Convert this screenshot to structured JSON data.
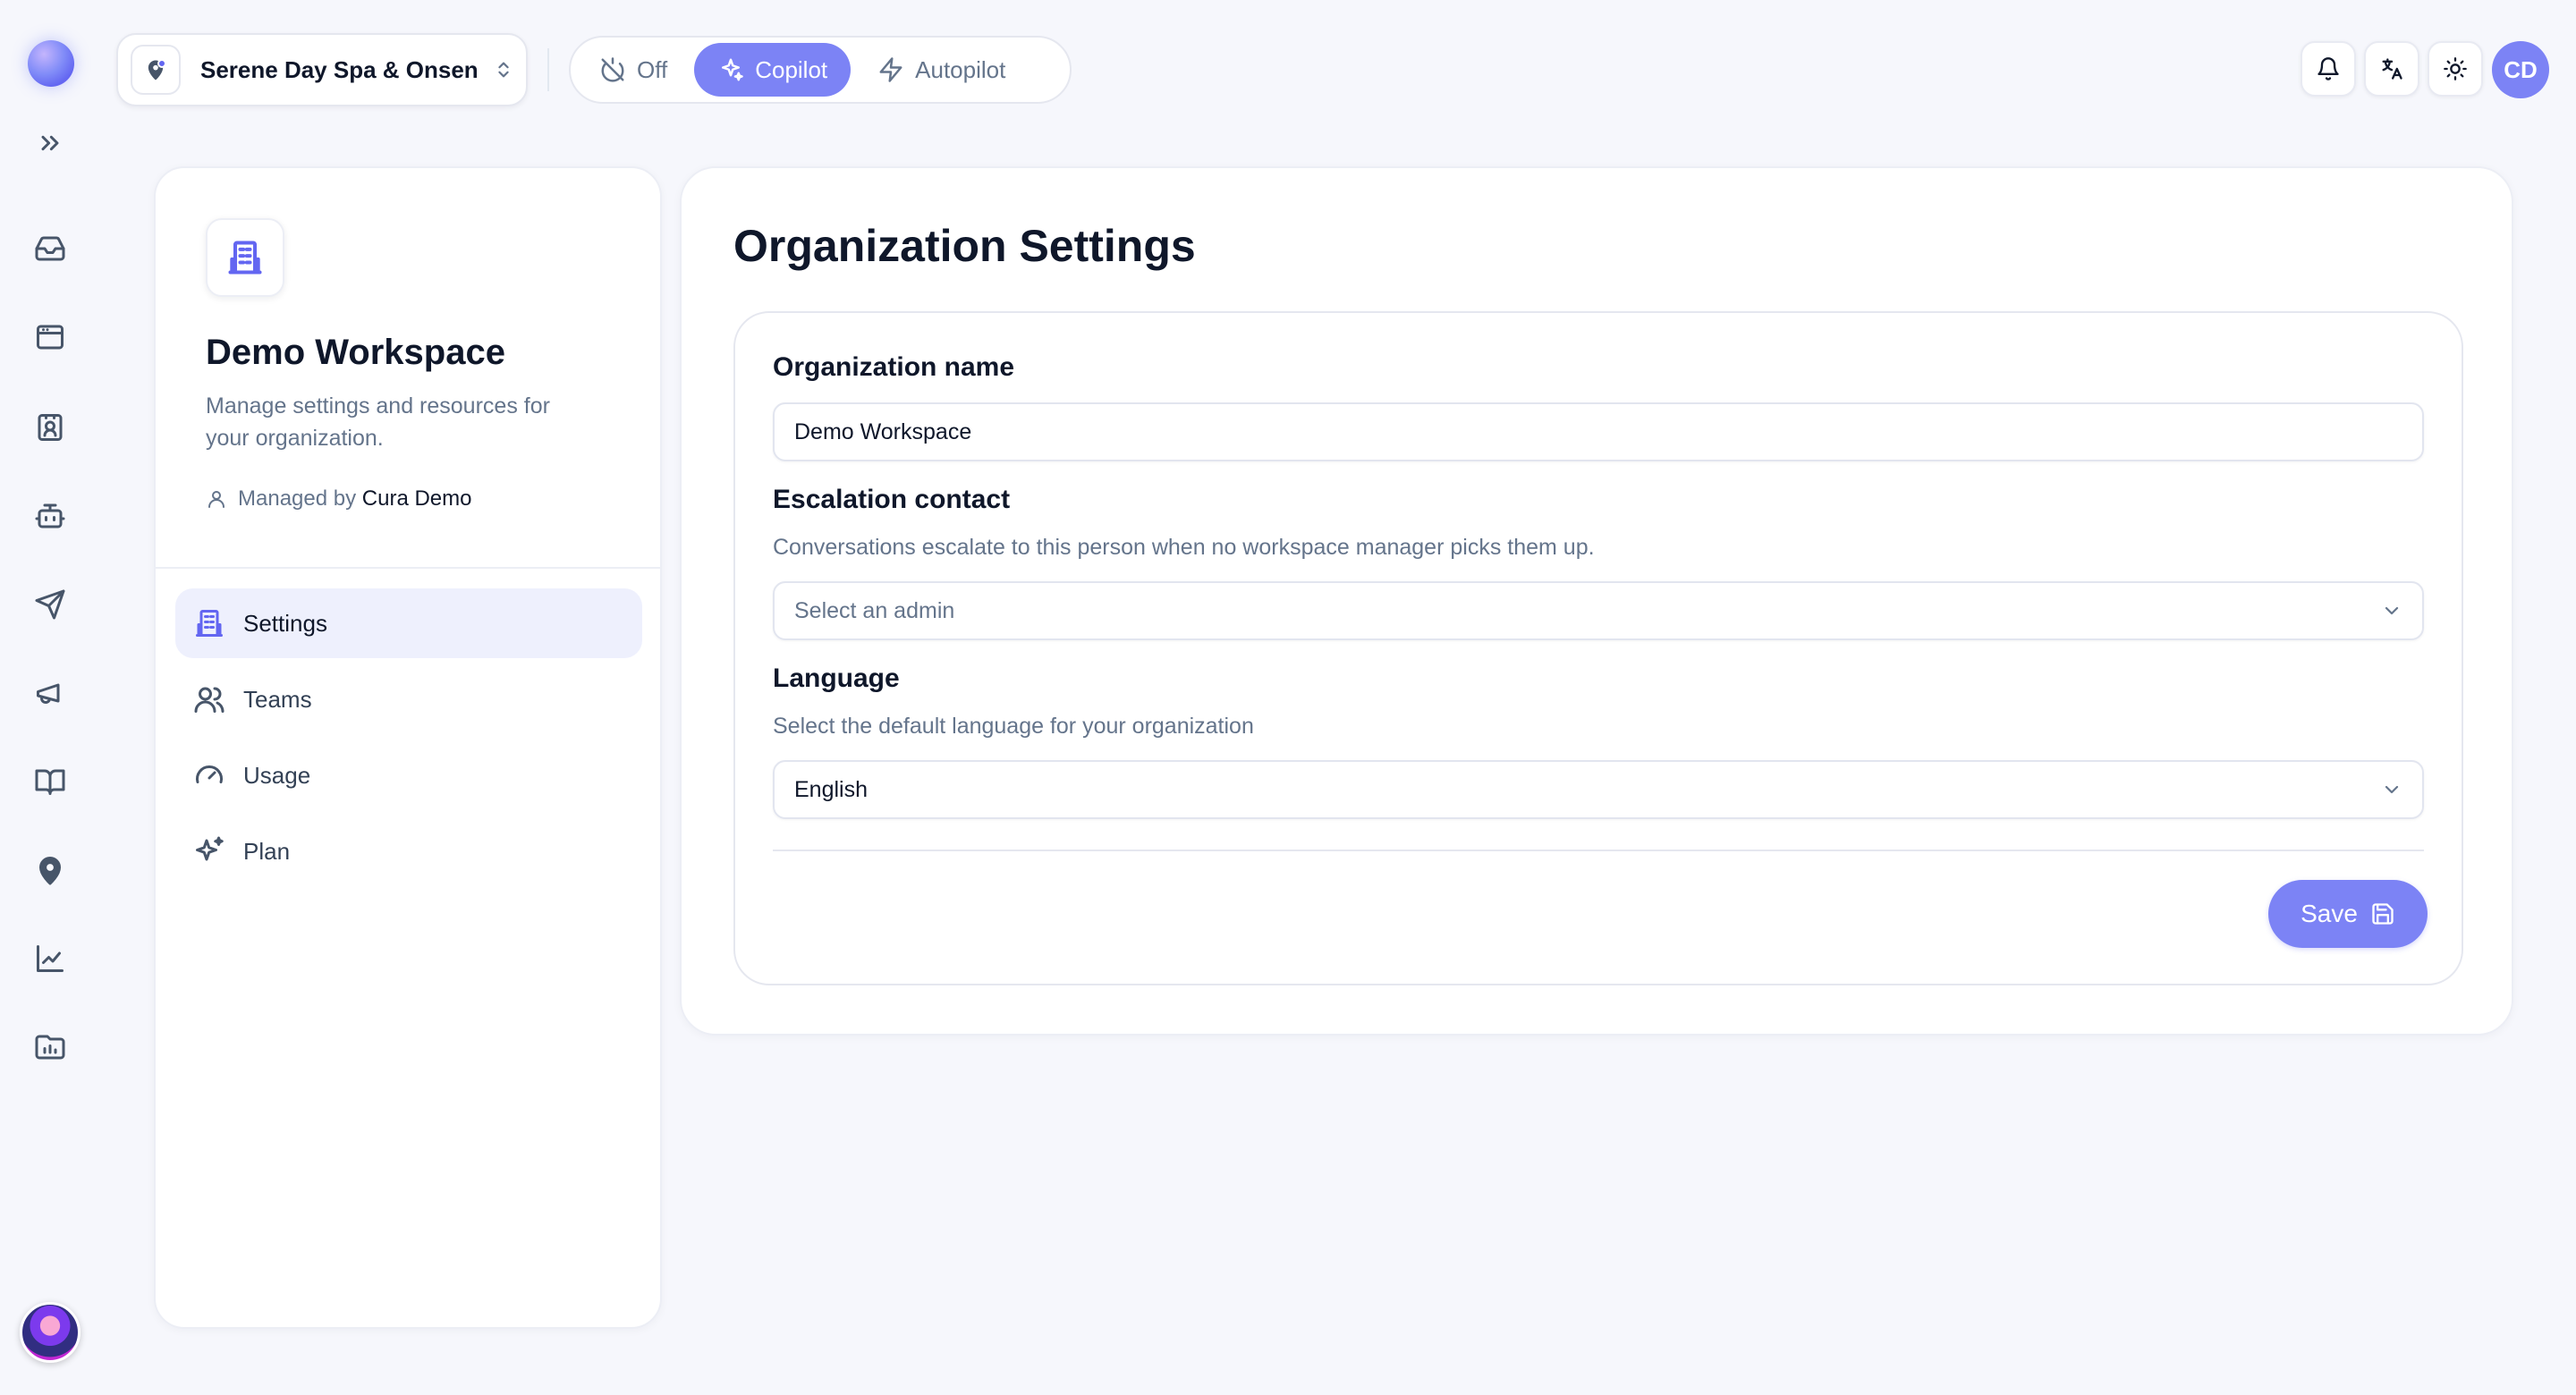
{
  "workspace_selector": {
    "name": "Serene Day Spa & Onsen",
    "icon": "map-pin-icon"
  },
  "modes": [
    {
      "label": "Off",
      "icon": "power-off-icon",
      "active": false
    },
    {
      "label": "Copilot",
      "icon": "sparkles-icon",
      "active": true
    },
    {
      "label": "Autopilot",
      "icon": "zap-icon",
      "active": false
    }
  ],
  "topbar": {
    "avatar_initials": "CD"
  },
  "rail": {
    "items": [
      "inbox-icon",
      "browser-icon",
      "contact-card-icon",
      "bot-icon",
      "send-icon",
      "megaphone-icon",
      "book-icon",
      "location-icon",
      "chart-icon",
      "folder-chart-icon"
    ]
  },
  "sidebar": {
    "title": "Demo Workspace",
    "description": "Manage settings and resources for your organization.",
    "managed_by_label": "Managed by",
    "managed_by_name": "Cura Demo",
    "nav": [
      {
        "label": "Settings",
        "icon": "building-icon",
        "active": true
      },
      {
        "label": "Teams",
        "icon": "users-icon",
        "active": false
      },
      {
        "label": "Usage",
        "icon": "gauge-icon",
        "active": false
      },
      {
        "label": "Plan",
        "icon": "sparkles-icon",
        "active": false
      }
    ]
  },
  "main": {
    "title": "Organization Settings",
    "org_name": {
      "label": "Organization name",
      "value": "Demo Workspace"
    },
    "escalation": {
      "label": "Escalation contact",
      "hint": "Conversations escalate to this person when no workspace manager picks them up.",
      "placeholder": "Select an admin"
    },
    "language": {
      "label": "Language",
      "hint": "Select the default language for your organization",
      "value": "English"
    },
    "save_label": "Save"
  },
  "colors": {
    "accent": "#7c83f5",
    "accent_dark": "#6366f1",
    "background": "#f6f7fc"
  }
}
